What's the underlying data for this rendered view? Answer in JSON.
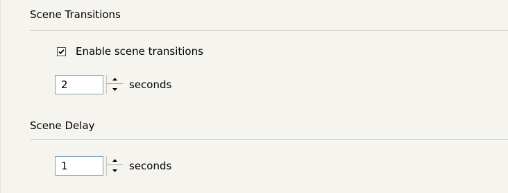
{
  "transitions": {
    "header": "Scene Transitions",
    "enable_label": "Enable scene transitions",
    "enabled": true,
    "value": "2",
    "unit": "seconds"
  },
  "delay": {
    "header": "Scene Delay",
    "value": "1",
    "unit": "seconds"
  },
  "icons": {
    "check": "checkmark-icon",
    "up": "spin-up-arrow-icon",
    "down": "spin-down-arrow-icon"
  }
}
